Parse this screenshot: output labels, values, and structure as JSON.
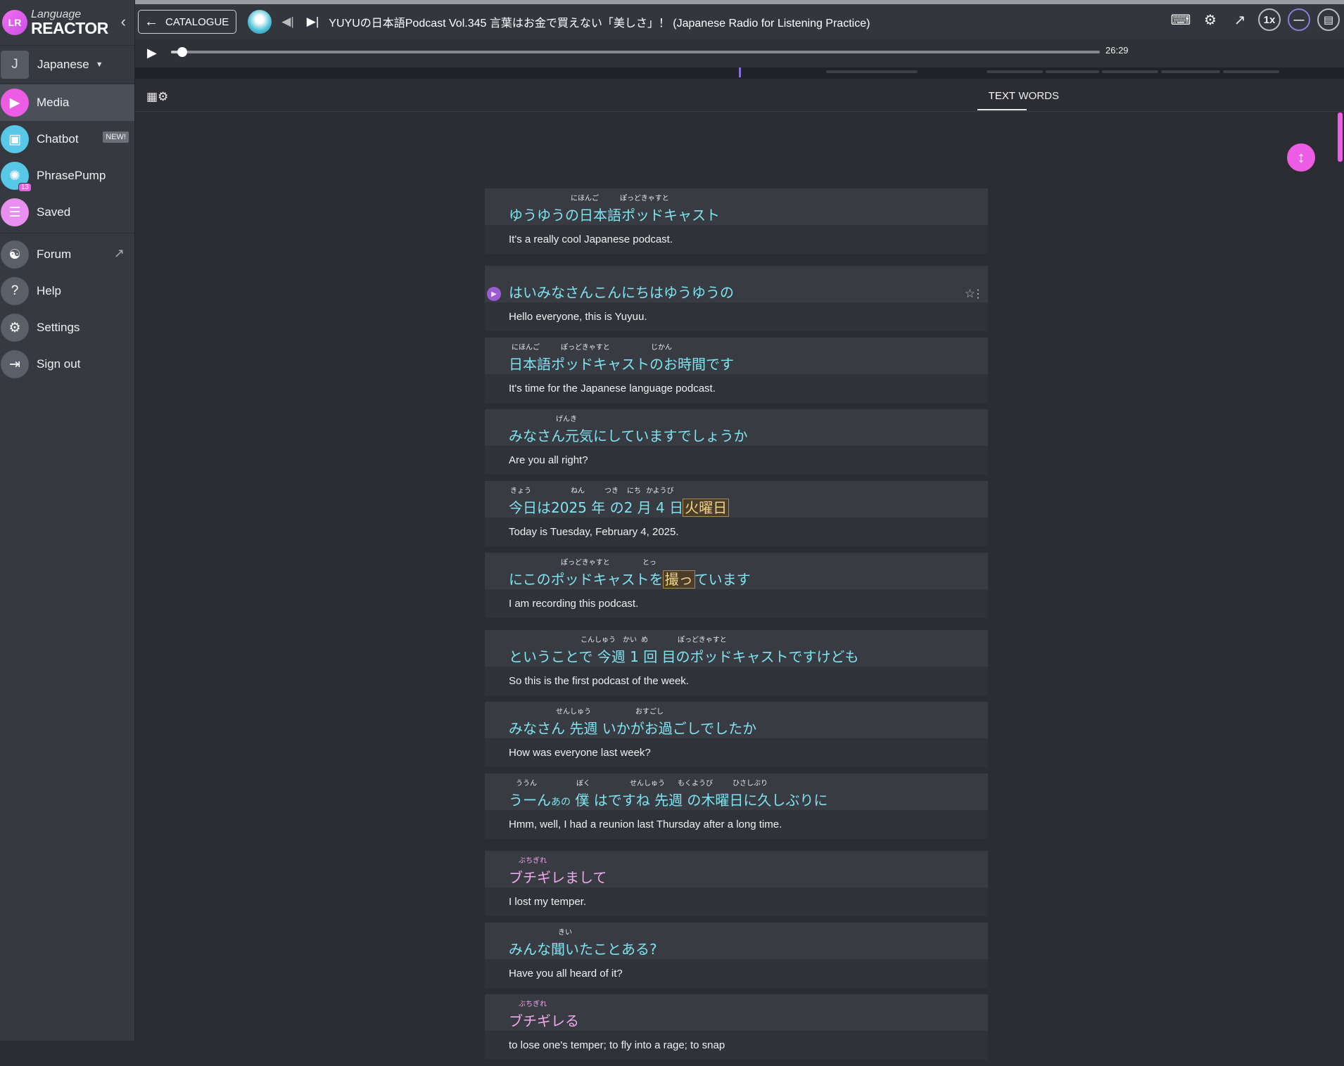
{
  "app": {
    "logo_line1": "Language",
    "logo_line2": "REACTOR",
    "logo_badge": "LR"
  },
  "sidebar": {
    "language": {
      "initial": "J",
      "name": "Japanese"
    },
    "items": [
      {
        "label": "Media",
        "icon": "play-icon"
      },
      {
        "label": "Chatbot",
        "icon": "chat-icon",
        "badge": "NEW!"
      },
      {
        "label": "PhrasePump",
        "icon": "phrasepump-icon",
        "count": "13"
      },
      {
        "label": "Saved",
        "icon": "list-icon"
      },
      {
        "label": "Forum",
        "icon": "figure-icon"
      },
      {
        "label": "Help",
        "icon": "help-icon"
      },
      {
        "label": "Settings",
        "icon": "gear-icon"
      },
      {
        "label": "Sign out",
        "icon": "signout-icon"
      }
    ]
  },
  "topbar": {
    "catalogue_label": "CATALOGUE",
    "title": "YUYUの日本語Podcast Vol.345 言葉はお金で買えない「美しさ」！ (Japanese Radio for Listening Practice)",
    "speed": "1x"
  },
  "player": {
    "duration": "26:29",
    "progress_fraction": 0.01
  },
  "tabs": {
    "text": "TEXT",
    "words": "WORDS",
    "active": "TEXT"
  },
  "accent_color": "#ec5ce4",
  "transcript": [
    {
      "jp": "ゆうゆうの日本語ポッドキャスト",
      "en": "It's a really cool Japanese podcast.",
      "furigana": [
        {
          "text": "にほんご",
          "offset": 88
        },
        {
          "text": "ぽっどきゃすと",
          "offset": 158
        }
      ]
    },
    {
      "jp": "はいみなさんこんにちはゆうゆうの",
      "en": "Hello everyone, this is Yuyuu.",
      "current": true,
      "furigana": []
    },
    {
      "jp": "日本語ポッドキャストのお時間です",
      "en": "It's time for the Japanese language podcast.",
      "furigana": [
        {
          "text": "にほんご",
          "offset": 4
        },
        {
          "text": "ぽっどきゃすと",
          "offset": 74
        },
        {
          "text": "じかん",
          "offset": 202
        }
      ]
    },
    {
      "jp": "みなさん元気にしていますでしょうか",
      "en": "Are you all right?",
      "furigana": [
        {
          "text": "げんき",
          "offset": 67
        }
      ]
    },
    {
      "jp_parts": [
        {
          "t": "今日は2025 年 の2 月 4 日"
        },
        {
          "t": "火曜日",
          "hl": true
        }
      ],
      "en": "Today is Tuesday, February 4, 2025.",
      "furigana": [
        {
          "text": "きょう",
          "offset": 2
        },
        {
          "text": "ねん",
          "offset": 88
        },
        {
          "text": "つき",
          "offset": 136
        },
        {
          "text": "にち",
          "offset": 168
        },
        {
          "text": "かようび",
          "offset": 195
        }
      ]
    },
    {
      "jp_parts": [
        {
          "t": "にこのポッドキャストを"
        },
        {
          "t": "撮っ",
          "hl": true
        },
        {
          "t": "ています"
        }
      ],
      "en": "I am recording this podcast.",
      "furigana": [
        {
          "text": "ぽっどきゃすと",
          "offset": 74
        },
        {
          "text": "とっ",
          "offset": 190
        }
      ]
    },
    {
      "jp": "ということで  今週  1 回 目のポッドキャストですけども",
      "en": "So this is the first podcast of the week.",
      "furigana": [
        {
          "text": "こんしゅう",
          "offset": 102
        },
        {
          "text": "かい",
          "offset": 162
        },
        {
          "text": "め",
          "offset": 188
        },
        {
          "text": "ぽっどきゃすと",
          "offset": 240
        }
      ]
    },
    {
      "jp": "みなさん  先週  いかがお過ごしでしたか",
      "en": "How was everyone last week?",
      "furigana": [
        {
          "text": "せんしゅう",
          "offset": 67
        },
        {
          "text": "おすごし",
          "offset": 180
        }
      ]
    },
    {
      "jp_parts": [
        {
          "t": "うーん"
        },
        {
          "t": "あの",
          "small": true
        },
        {
          "t": " 僕 はですね  先週  の木曜日に久しぶりに"
        }
      ],
      "en": "Hmm, well, I had a reunion last Thursday after a long time.",
      "furigana": [
        {
          "text": "ううん",
          "offset": 10
        },
        {
          "text": "ぼく",
          "offset": 96
        },
        {
          "text": "せんしゅう",
          "offset": 172
        },
        {
          "text": "もくようび",
          "offset": 240
        },
        {
          "text": "ひさしぶり",
          "offset": 318
        }
      ],
      "gap_after": true
    },
    {
      "jp": "ブチギレまして",
      "en": "I lost my temper.",
      "jp_pink": true,
      "furigana": [
        {
          "text": "ぶちぎれ",
          "offset": 14,
          "pink": true
        }
      ]
    },
    {
      "jp": "みんな聞いたことある?",
      "en": "Have you all heard of it?",
      "furigana": [
        {
          "text": "きい",
          "offset": 70
        }
      ]
    },
    {
      "jp": "ブチギレる",
      "en": "to lose one's temper; to fly into a rage; to snap",
      "jp_pink": true,
      "furigana": [
        {
          "text": "ぶちぎれ",
          "offset": 14,
          "pink": true
        }
      ]
    }
  ]
}
